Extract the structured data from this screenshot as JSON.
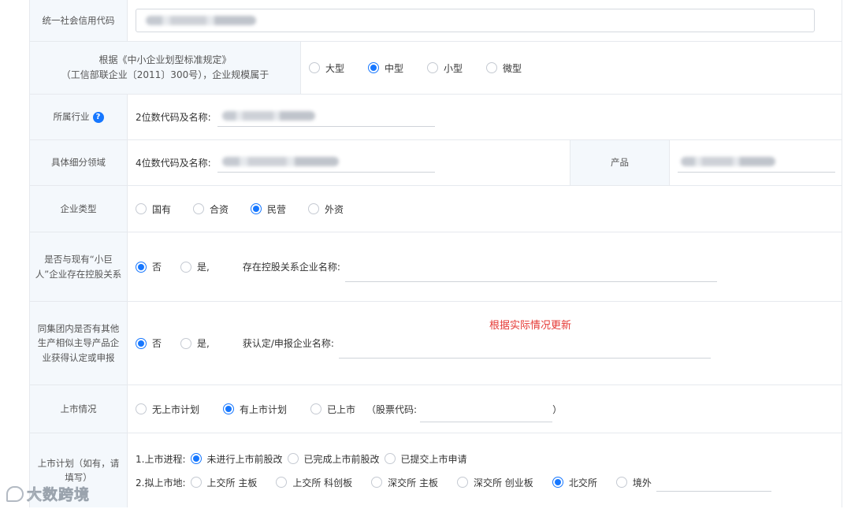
{
  "rows": {
    "credit_code": {
      "label": "统一社会信用代码"
    },
    "scale": {
      "label_line1": "根据《中小企业划型标准规定》",
      "label_line2": "（工信部联企业〔2011〕300号），企业规模属于",
      "options": [
        "大型",
        "中型",
        "小型",
        "微型"
      ],
      "selected": "中型"
    },
    "industry": {
      "label": "所属行业",
      "help_icon": "?",
      "field_label": "2位数代码及名称:"
    },
    "subfield": {
      "label": "具体细分领域",
      "field_label": "4位数代码及名称:",
      "product_label": "产品"
    },
    "enterprise_type": {
      "label": "企业类型",
      "options": [
        "国有",
        "合资",
        "民营",
        "外资"
      ],
      "selected": "民营"
    },
    "holding": {
      "label": "是否与现有“小巨人”企业存在控股关系",
      "options": [
        "否",
        "是,"
      ],
      "selected": "否",
      "field_label": "存在控股关系企业名称:"
    },
    "group": {
      "label": "同集团内是否有其他生产相似主导产品企业获得认定或申报",
      "options": [
        "否",
        "是,"
      ],
      "selected": "否",
      "field_label": "获认定/申报企业名称:",
      "note": "根据实际情况更新"
    },
    "listing": {
      "label": "上市情况",
      "options": [
        "无上市计划",
        "有上市计划",
        "已上市"
      ],
      "selected": "有上市计划",
      "stock_code_label": "（股票代码:",
      "close_paren": "）"
    },
    "listing_plan": {
      "label": "上市计划（如有，请填写）",
      "progress_label": "1.上市进程:",
      "progress_options": [
        "未进行上市前股改",
        "已完成上市前股改",
        "已提交上市申请"
      ],
      "progress_selected": "未进行上市前股改",
      "venue_label": "2.拟上市地:",
      "venue_options": [
        "上交所 主板",
        "上交所 科创板",
        "深交所 主板",
        "深交所 创业板",
        "北交所",
        "境外"
      ],
      "venue_selected": "北交所"
    }
  },
  "watermark": "大数跨境",
  "colors": {
    "accent": "#1677ff",
    "label_bg": "#f4f8fc",
    "note": "#e53935"
  }
}
